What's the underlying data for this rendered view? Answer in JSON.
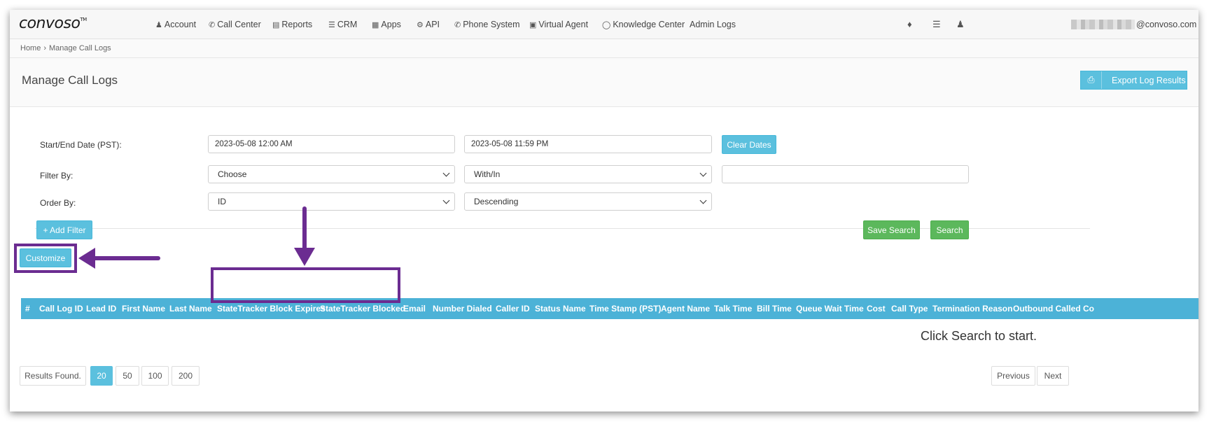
{
  "navbar": {
    "logo": "CONVOSO",
    "logo_mark": "TM",
    "items": [
      {
        "label": "Account",
        "icon": "user-icon"
      },
      {
        "label": "Call Center",
        "icon": "phone-icon"
      },
      {
        "label": "Reports",
        "icon": "bar-chart-icon"
      },
      {
        "label": "CRM",
        "icon": "list-icon"
      },
      {
        "label": "Apps",
        "icon": "grid-icon"
      },
      {
        "label": "API",
        "icon": "gear-icon"
      },
      {
        "label": "Phone System",
        "icon": "phone-icon"
      },
      {
        "label": "Virtual Agent",
        "icon": "monitor-icon"
      },
      {
        "label": "Knowledge Center",
        "icon": "lightbulb-icon"
      },
      {
        "label": "Admin Logs",
        "icon": ""
      }
    ],
    "user_email_domain": "@convoso.com"
  },
  "breadcrumb": {
    "home": "Home",
    "separator": "›",
    "current": "Manage Call Logs"
  },
  "page": {
    "title": "Manage Call Logs",
    "export_label": "Export Log Results"
  },
  "filters": {
    "date_label": "Start/End Date (PST):",
    "start_date": "2023-05-08 12:00 AM",
    "end_date": "2023-05-08 11:59 PM",
    "clear_dates": "Clear Dates",
    "filter_label": "Filter By:",
    "filter_field": "Choose",
    "filter_operator": "With/In",
    "filter_value": "",
    "order_label": "Order By:",
    "order_field": "ID",
    "order_direction": "Descending",
    "add_filter": "+ Add Filter",
    "save_search": "Save Search",
    "search": "Search"
  },
  "customize_label": "Customize",
  "table": {
    "columns": [
      "#",
      "Call Log ID",
      "Lead ID",
      "First Name",
      "Last Name",
      "StateTracker Block Expires",
      "StateTracker Blocked",
      "Email",
      "Number Dialed",
      "Caller ID",
      "Status Name",
      "Time Stamp (PST)",
      "Agent Name",
      "Talk Time",
      "Bill Time",
      "Queue Wait Time",
      "Cost",
      "Call Type",
      "Termination Reason",
      "Outbound Called Co"
    ],
    "empty_message": "Click Search to start."
  },
  "pagination": {
    "results_label": "Results Found.",
    "page_sizes": [
      "20",
      "50",
      "100",
      "200"
    ],
    "active_size": "20",
    "previous": "Previous",
    "next": "Next"
  },
  "annotations": {
    "highlight_color": "#6b2c91"
  }
}
